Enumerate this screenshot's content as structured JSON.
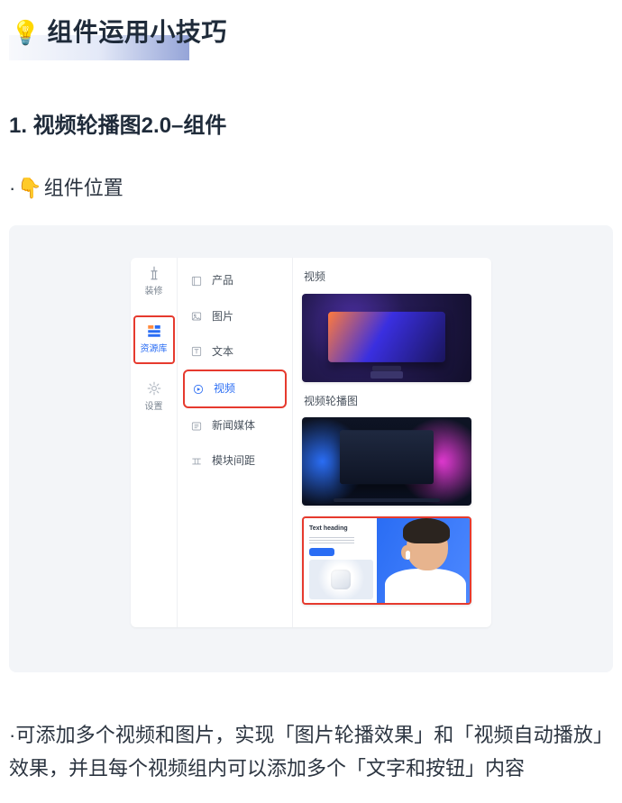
{
  "title": {
    "emoji": "💡",
    "text": "组件运用小技巧"
  },
  "section1": {
    "heading": "1. 视频轮播图2.0–组件",
    "location_prefix": "·",
    "location_emoji": "👇",
    "location_label": "组件位置"
  },
  "editor": {
    "rail": {
      "decorate": {
        "label": "装修"
      },
      "library": {
        "label": "资源库"
      },
      "settings": {
        "label": "设置"
      }
    },
    "menu": {
      "product": "产品",
      "image": "图片",
      "text": "文本",
      "video": "视频",
      "news": "新闻媒体",
      "spacing": "模块间距"
    },
    "preview": {
      "video_head": "视频",
      "carousel_head": "视频轮播图",
      "split_card_title": "Text heading"
    }
  },
  "bullet": {
    "prefix": "·",
    "text": "可添加多个视频和图片，实现「图片轮播效果」和「视频自动播放」效果，并且每个视频组内可以添加多个「文字和按钮」内容"
  }
}
